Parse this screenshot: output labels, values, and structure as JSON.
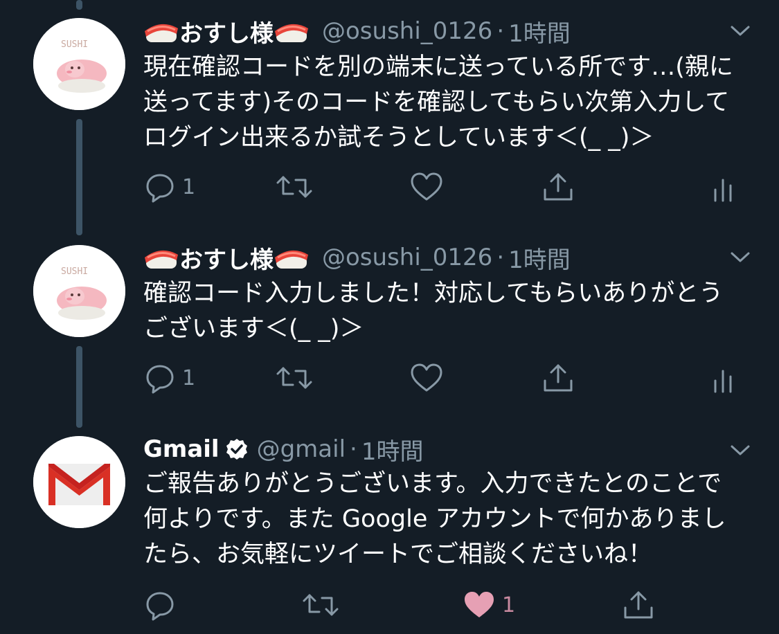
{
  "tweets": [
    {
      "display_name": "おすし様",
      "handle": "@osushi_0126",
      "dot": "·",
      "time": "1時間",
      "text": "現在確認コードを別の端末に送っている所です…(親に送ってます)そのコードを確認してもらい次第入力してログイン出来るか試そうとしています＜(_ _)＞",
      "reply_count": "1",
      "like_count": "",
      "avatar_label": "SUSHI"
    },
    {
      "display_name": "おすし様",
      "handle": "@osushi_0126",
      "dot": "·",
      "time": "1時間",
      "text": "確認コード入力しました！対応してもらいありがとうございます＜(_ _)＞",
      "reply_count": "1",
      "like_count": "",
      "avatar_label": "SUSHI"
    },
    {
      "display_name": "Gmail",
      "handle": "@gmail",
      "dot": "·",
      "time": "1時間",
      "text": "ご報告ありがとうございます。入力できたとのことで何よりです。また Google アカウントで何かありましたら、お気軽にツイートでご相談くださいね！",
      "reply_count": "",
      "like_count": "1",
      "verified": true
    }
  ],
  "colors": {
    "background": "#141d26",
    "secondary_text": "#8899a6",
    "thread_line": "#3d5466",
    "like_active": "#e0245e",
    "gmail_red": "#d93025"
  }
}
